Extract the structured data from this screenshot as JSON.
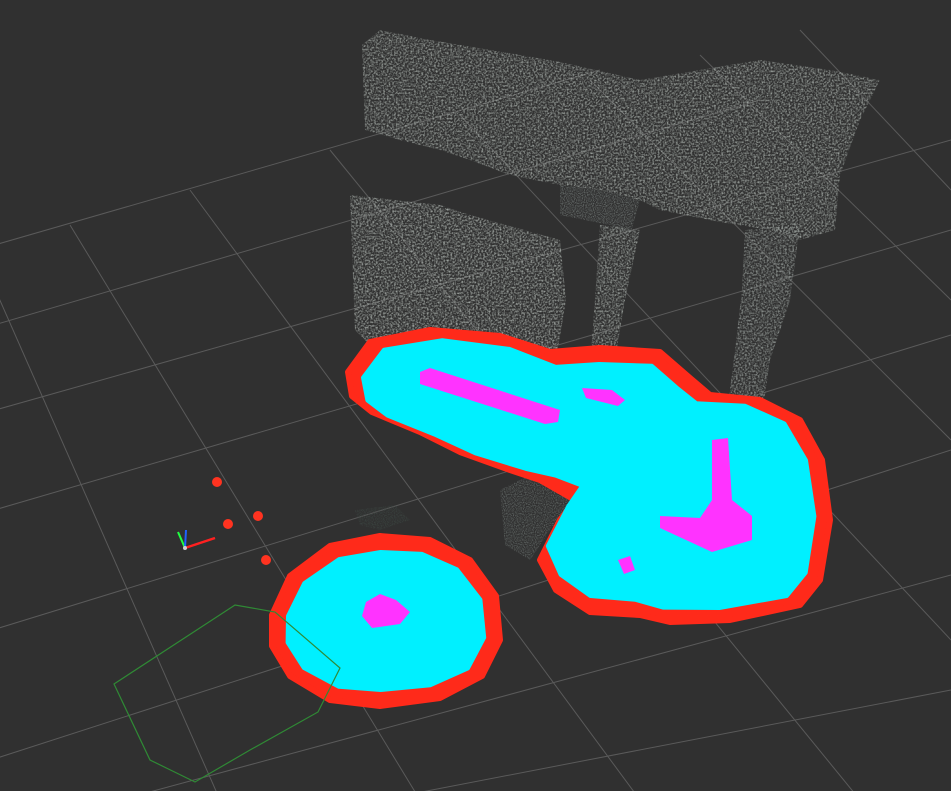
{
  "viewport": {
    "background": "#303030",
    "grid_color": "#5a5a5a",
    "layers": [
      "grid",
      "point-cloud",
      "costmap-inflation",
      "costmap-lethal",
      "obstacle-cells",
      "robot-axes",
      "particle-markers",
      "robot-footprint"
    ]
  },
  "colors": {
    "cloud": "#9aa09c",
    "cloud_dark": "#5f6563",
    "inflation_outer": "#ff2a1a",
    "inflation_inner": "#00f0ff",
    "lethal": "#ff33ff",
    "footprint": "#2f8a35",
    "marker": "#ff3320",
    "axis_x": "#ff2020",
    "axis_y": "#20ff40",
    "axis_z": "#2060ff"
  },
  "icons": {
    "robot_frame": "robot-frame-axes-icon",
    "marker": "particle-marker-icon"
  }
}
